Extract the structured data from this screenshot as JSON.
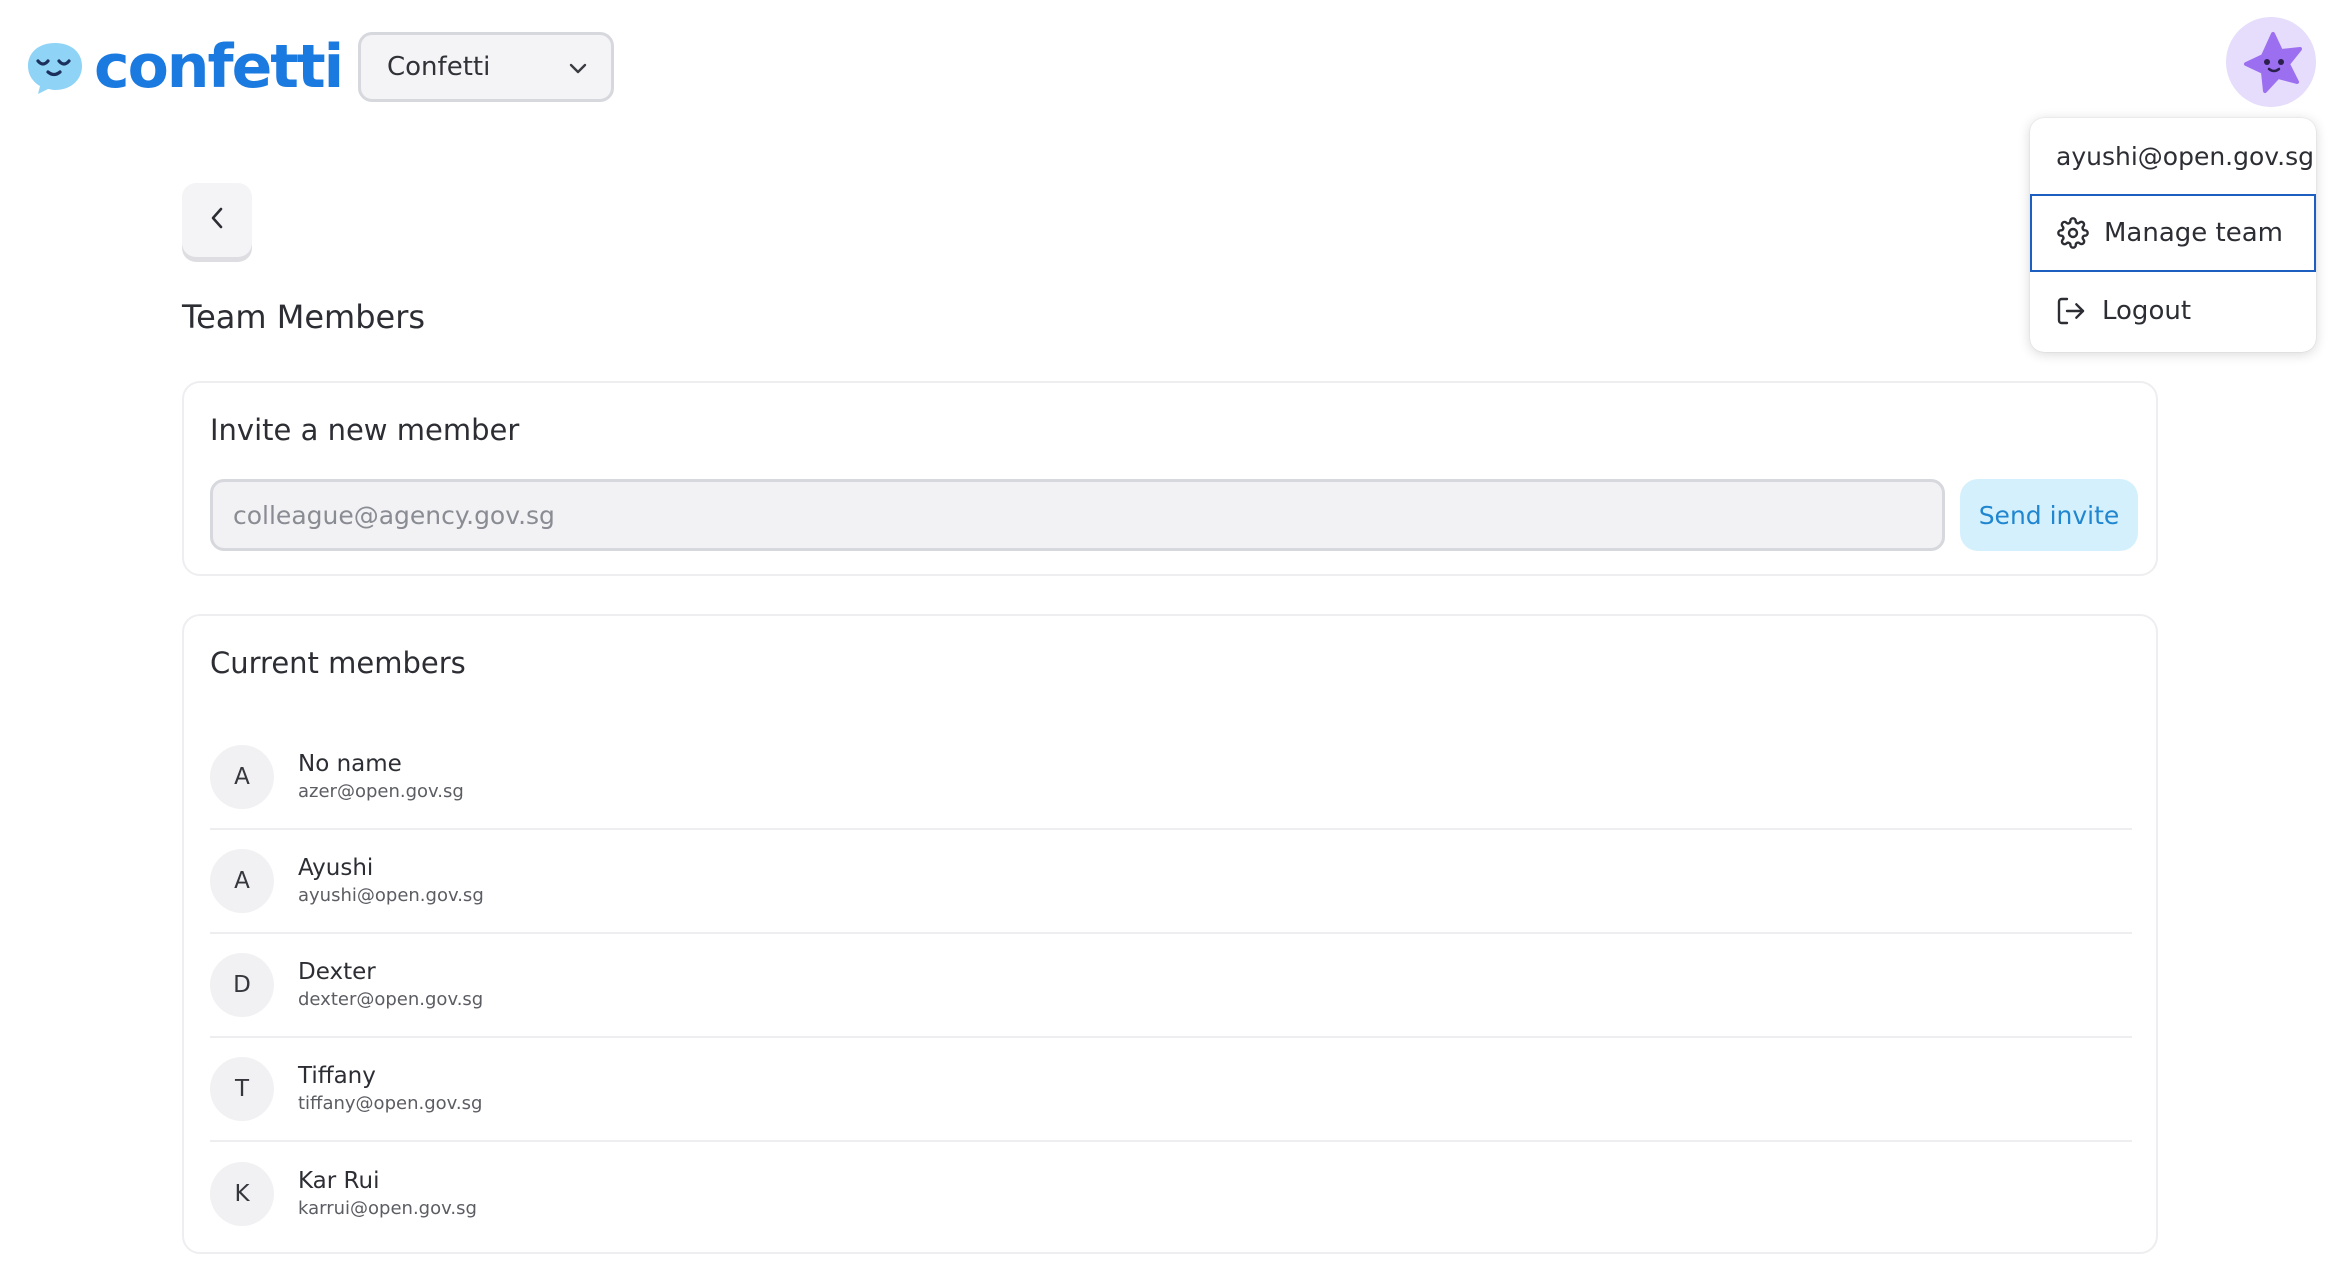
{
  "header": {
    "logo_text": "confetti",
    "team_select_value": "Confetti"
  },
  "user_menu": {
    "email": "ayushi@open.gov.sg",
    "items": [
      {
        "label": "Manage team",
        "icon": "gear-icon"
      },
      {
        "label": "Logout",
        "icon": "logout-icon"
      }
    ]
  },
  "page": {
    "title": "Team Members"
  },
  "invite": {
    "title": "Invite a new member",
    "placeholder": "colleague@agency.gov.sg",
    "button_label": "Send invite"
  },
  "members": {
    "title": "Current members",
    "list": [
      {
        "initial": "A",
        "name": "No name",
        "email": "azer@open.gov.sg"
      },
      {
        "initial": "A",
        "name": "Ayushi",
        "email": "ayushi@open.gov.sg"
      },
      {
        "initial": "D",
        "name": "Dexter",
        "email": "dexter@open.gov.sg"
      },
      {
        "initial": "T",
        "name": "Tiffany",
        "email": "tiffany@open.gov.sg"
      },
      {
        "initial": "K",
        "name": "Kar Rui",
        "email": "karrui@open.gov.sg"
      }
    ]
  },
  "colors": {
    "brand_blue": "#1a7ae0",
    "logo_bubble": "#8fd3f7",
    "avatar_bg": "#e6dcfb",
    "avatar_star": "#9b6ff0",
    "send_button_bg": "#d5f0fd",
    "send_button_text": "#1f86cf"
  }
}
